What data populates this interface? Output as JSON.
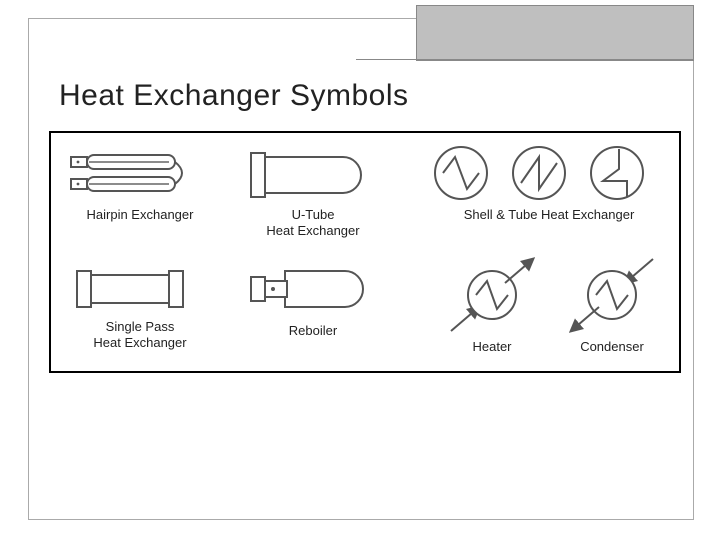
{
  "title": "Heat Exchanger Symbols",
  "symbols": {
    "hairpin": {
      "label": "Hairpin Exchanger"
    },
    "utube": {
      "label": "U-Tube\nHeat Exchanger"
    },
    "shelltube": {
      "label": "Shell & Tube Heat  Exchanger"
    },
    "singlepass": {
      "label": "Single Pass\nHeat Exchanger"
    },
    "reboiler": {
      "label": "Reboiler"
    },
    "heater": {
      "label": "Heater"
    },
    "condenser": {
      "label": "Condenser"
    }
  }
}
